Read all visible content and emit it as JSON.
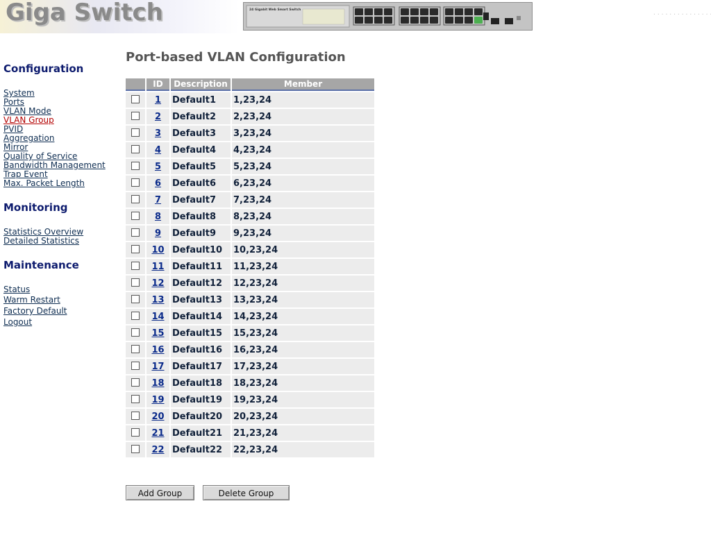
{
  "header": {
    "title": "Giga Switch",
    "image_label": "24 Gigabit Web Smart Switch",
    "dots": "..............."
  },
  "sidebar": {
    "configuration": {
      "title": "Configuration",
      "items": [
        "System",
        "Ports",
        "VLAN Mode",
        "VLAN Group",
        "PVID",
        "Aggregation",
        "Mirror",
        "Quality of Service",
        "Bandwidth Management",
        "Trap Event",
        "Max. Packet Length"
      ],
      "active_index": 3
    },
    "monitoring": {
      "title": "Monitoring",
      "items": [
        "Statistics Overview",
        "Detailed Statistics"
      ]
    },
    "maintenance": {
      "title": "Maintenance",
      "items": [
        "Status",
        "Warm Restart",
        "Factory Default",
        "Logout"
      ]
    }
  },
  "main": {
    "title": "Port-based VLAN Configuration",
    "table": {
      "headers": [
        "",
        "ID",
        "Description",
        "Member"
      ],
      "rows": [
        {
          "id": "1",
          "description": "Default1",
          "member": "1,23,24",
          "checked": false
        },
        {
          "id": "2",
          "description": "Default2",
          "member": "2,23,24",
          "checked": false
        },
        {
          "id": "3",
          "description": "Default3",
          "member": "3,23,24",
          "checked": false
        },
        {
          "id": "4",
          "description": "Default4",
          "member": "4,23,24",
          "checked": false
        },
        {
          "id": "5",
          "description": "Default5",
          "member": "5,23,24",
          "checked": false
        },
        {
          "id": "6",
          "description": "Default6",
          "member": "6,23,24",
          "checked": false
        },
        {
          "id": "7",
          "description": "Default7",
          "member": "7,23,24",
          "checked": false
        },
        {
          "id": "8",
          "description": "Default8",
          "member": "8,23,24",
          "checked": false
        },
        {
          "id": "9",
          "description": "Default9",
          "member": "9,23,24",
          "checked": false
        },
        {
          "id": "10",
          "description": "Default10",
          "member": "10,23,24",
          "checked": false
        },
        {
          "id": "11",
          "description": "Default11",
          "member": "11,23,24",
          "checked": false
        },
        {
          "id": "12",
          "description": "Default12",
          "member": "12,23,24",
          "checked": false
        },
        {
          "id": "13",
          "description": "Default13",
          "member": "13,23,24",
          "checked": false
        },
        {
          "id": "14",
          "description": "Default14",
          "member": "14,23,24",
          "checked": false
        },
        {
          "id": "15",
          "description": "Default15",
          "member": "15,23,24",
          "checked": false
        },
        {
          "id": "16",
          "description": "Default16",
          "member": "16,23,24",
          "checked": false
        },
        {
          "id": "17",
          "description": "Default17",
          "member": "17,23,24",
          "checked": false
        },
        {
          "id": "18",
          "description": "Default18",
          "member": "18,23,24",
          "checked": false
        },
        {
          "id": "19",
          "description": "Default19",
          "member": "19,23,24",
          "checked": false
        },
        {
          "id": "20",
          "description": "Default20",
          "member": "20,23,24",
          "checked": false
        },
        {
          "id": "21",
          "description": "Default21",
          "member": "21,23,24",
          "checked": false
        },
        {
          "id": "22",
          "description": "Default22",
          "member": "22,23,24",
          "checked": false
        }
      ]
    },
    "buttons": {
      "add_label": "Add Group",
      "delete_label": "Delete Group"
    }
  },
  "colors": {
    "nav_link": "#0f2e52",
    "nav_active": "#b30000",
    "section_title": "#0d1b6e",
    "table_header_bg": "#a6a6a6",
    "table_cell_bg": "#ececec",
    "id_link": "#0a2a8a"
  }
}
